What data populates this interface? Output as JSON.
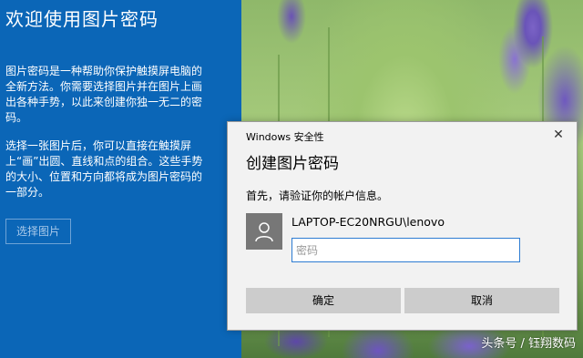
{
  "left_panel": {
    "title": "欢迎使用图片密码",
    "para1": "图片密码是一种帮助你保护触摸屏电脑的全新方法。你需要选择图片并在图片上画出各种手势，以此来创建你独一无二的密码。",
    "para2": "选择一张图片后，你可以直接在触摸屏上“画”出圆、直线和点的组合。这些手势的大小、位置和方向都将成为图片密码的一部分。",
    "choose_button": "选择图片"
  },
  "dialog": {
    "app_title": "Windows 安全性",
    "close_glyph": "✕",
    "title": "创建图片密码",
    "subtitle": "首先，请验证你的帐户信息。",
    "user_name": "LAPTOP-EC20NRGU\\lenovo",
    "password_placeholder": "密码",
    "ok_label": "确定",
    "cancel_label": "取消",
    "avatar_icon": "user-silhouette-icon"
  },
  "watermark": "头条号 / 钰翔数码",
  "colors": {
    "panel_blue": "#0b66b7",
    "dialog_bg": "#f2f2f2",
    "button_gray": "#cccccc",
    "input_border": "#2d7cd2"
  }
}
